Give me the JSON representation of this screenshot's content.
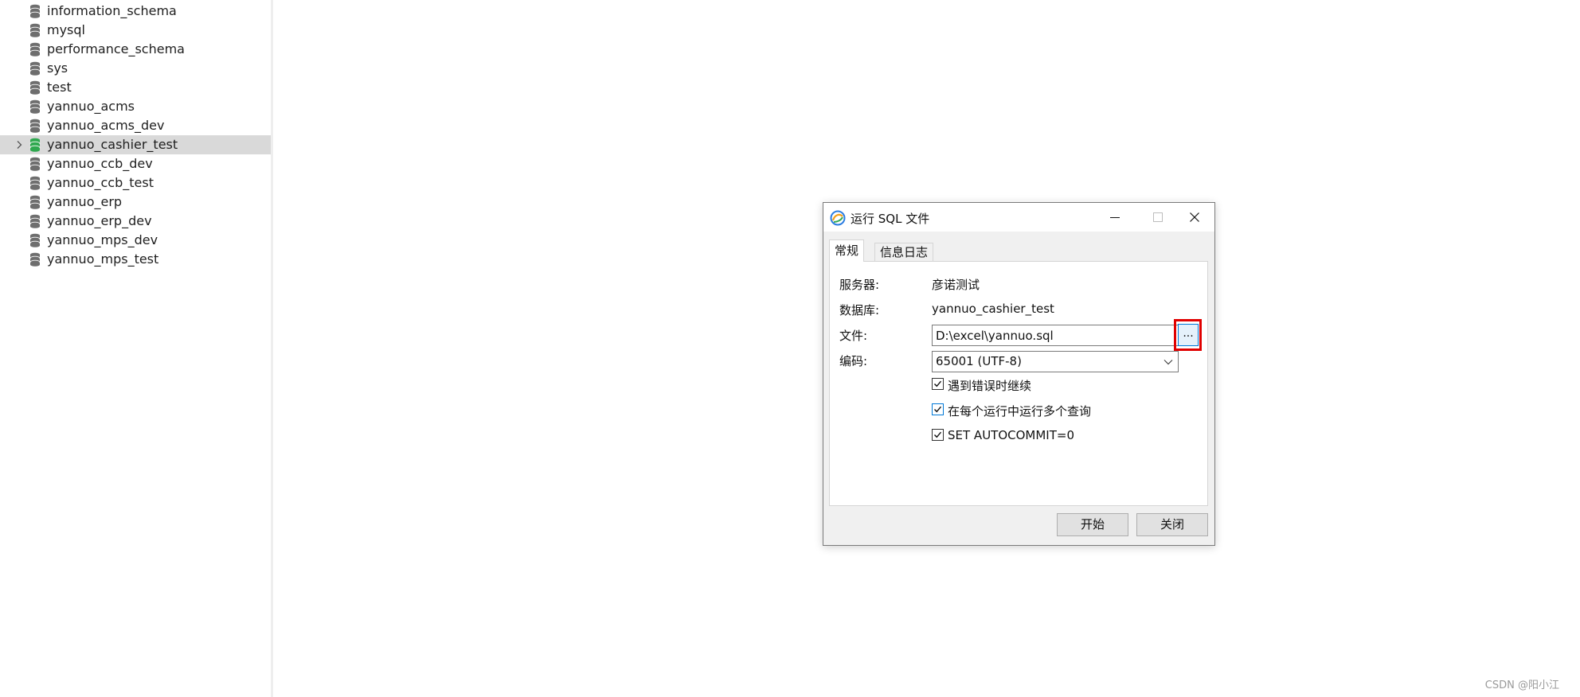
{
  "sidebar": {
    "items": [
      {
        "label": "information_schema"
      },
      {
        "label": "mysql"
      },
      {
        "label": "performance_schema"
      },
      {
        "label": "sys"
      },
      {
        "label": "test"
      },
      {
        "label": "yannuo_acms"
      },
      {
        "label": "yannuo_acms_dev"
      },
      {
        "label": "yannuo_cashier_test"
      },
      {
        "label": "yannuo_ccb_dev"
      },
      {
        "label": "yannuo_ccb_test"
      },
      {
        "label": "yannuo_erp"
      },
      {
        "label": "yannuo_erp_dev"
      },
      {
        "label": "yannuo_mps_dev"
      },
      {
        "label": "yannuo_mps_test"
      }
    ],
    "selected_index": 7
  },
  "dialog": {
    "title": "运行 SQL 文件",
    "tabs": [
      "常规",
      "信息日志"
    ],
    "fields": {
      "server_label": "服务器:",
      "server_value": "彦诺测试",
      "database_label": "数据库:",
      "database_value": "yannuo_cashier_test",
      "file_label": "文件:",
      "file_value": "D:\\excel\\yannuo.sql",
      "browse_label": "...",
      "encoding_label": "编码:",
      "encoding_value": "65001 (UTF-8)"
    },
    "options": [
      {
        "label": "遇到错误时继续",
        "checked": true
      },
      {
        "label": "在每个运行中运行多个查询",
        "checked": true
      },
      {
        "label": "SET AUTOCOMMIT=0",
        "checked": true
      }
    ],
    "buttons": {
      "start": "开始",
      "close": "关闭"
    }
  },
  "watermark": "CSDN @阳小江",
  "colors": {
    "selected_db_icon": "#2fa84f",
    "db_icon": "#6e6e6e",
    "highlight_box": "#e00000",
    "accent": "#0078d7"
  }
}
